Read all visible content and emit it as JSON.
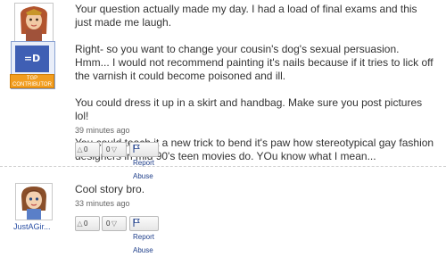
{
  "answers": [
    {
      "user_badge": {
        "label": "=D",
        "caption": "TGP CONTRIBUTOR"
      },
      "paragraphs": [
        "Your question actually made my day. I had a load of final exams and this just made me laugh.",
        "Right- so you want to change your cousin's dog's sexual persuasion. Hmm... I would not recommend painting it's nails because if it tries to lick off the varnish it could become poisoned and ill.",
        "You could dress it up in a skirt and handbag. Make sure you post pictures lol!",
        "You could teach it a new trick to bend it's paw how stereotypical gay fashion designers in mid 90's teen movies do. YOu know what I mean..."
      ],
      "time": "39 minutes ago",
      "thumbs_up": "0",
      "thumbs_down": "0",
      "report_label": "Report Abuse"
    },
    {
      "username": "JustAGir...",
      "paragraphs": [
        "Cool story bro."
      ],
      "time": "33 minutes ago",
      "thumbs_up": "0",
      "thumbs_down": "0",
      "report_label": "Report Abuse"
    }
  ],
  "colors": {
    "link": "#2a4fa3",
    "badge": "#3f5fb4",
    "contributor": "#f29d1f"
  }
}
